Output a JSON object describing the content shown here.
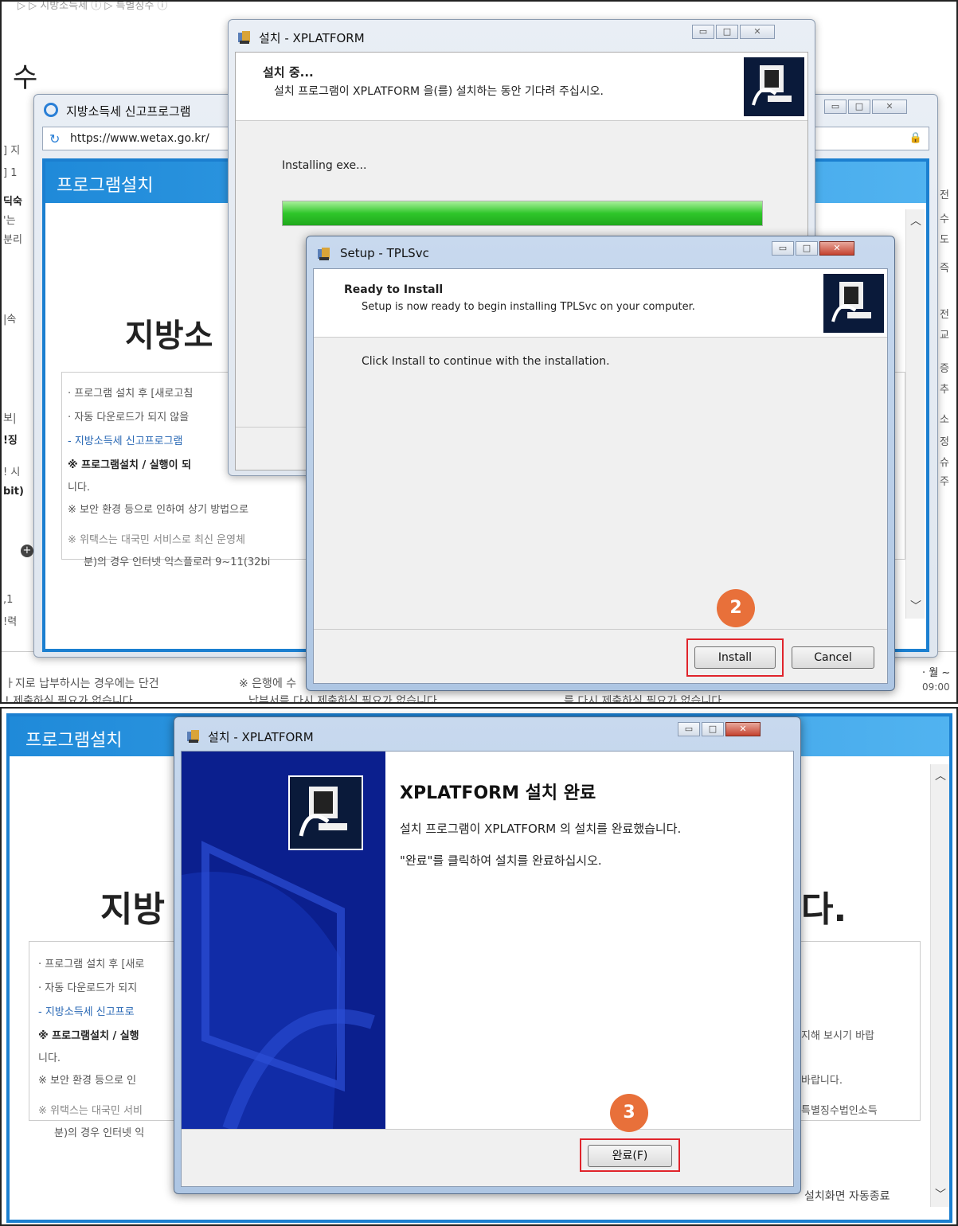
{
  "panel1": {
    "bg_page": {
      "heading_char": "수",
      "breadcrumb_hint": "",
      "left_frags": [
        "] 지",
        "] 1",
        "딕숙",
        "'는",
        "분리",
        "|속",
        "보|",
        "!징",
        "! 시",
        "bit)",
        ",1",
        "!력"
      ],
      "right_frags": [
        "전",
        "수",
        "도",
        "즉",
        "전",
        "교",
        "증",
        "추",
        "소",
        "정",
        "슈",
        "주"
      ],
      "bottom_left": "ㅏ지로 납부하시는 경우에는 단건",
      "bottom_left2": "! 제출하실 필요가 없습니다",
      "bottom_mid": "※ 은행에 수",
      "bottom_mid2": "납부서를 다시 제출하실 필요가 없습니다",
      "bottom_right2": "를 다시 제출하실 필요가 없습니다",
      "right_small1": "· 월 ~",
      "right_small2": "09:00"
    },
    "browser": {
      "title": "지방소득세 신고프로그램",
      "url": "https://www.wetax.go.kr/",
      "panel_title": "프로그램설치",
      "big_heading": "지방소",
      "lines": [
        "· 프로그램 설치 후 [새로고침",
        "· 자동 다운로드가 되지 않을",
        "- 지방소득세 신고프로그램",
        "※ 프로그램설치 / 실행이 되",
        "니다.",
        "※ 보안 환경 등으로 인하여 상기 방법으로",
        "※ 위택스는 대국민 서비스로 최신 운영체",
        "분)의 경우 인터넷 익스플로러 9~11(32bi"
      ]
    },
    "xplatform_dialog": {
      "title": "설치 - XPLATFORM",
      "header_title": "설치 중...",
      "header_sub": "설치 프로그램이 XPLATFORM 을(를) 설치하는 동안 기다려 주십시오.",
      "status": "Installing exe...",
      "progress": 1.0
    },
    "tplsvc_dialog": {
      "title": "Setup - TPLSvc",
      "header_title": "Ready to Install",
      "header_sub": "Setup is now ready to begin installing TPLSvc on your computer.",
      "body": "Click Install to continue with the installation.",
      "install_label": "Install",
      "cancel_label": "Cancel",
      "step_badge": "2"
    }
  },
  "panel2": {
    "bg_page": {
      "panel_title": "프로그램설치",
      "big_left": "지방",
      "big_right": "다.",
      "lines": [
        "· 프로그램 설치 후 [새로",
        "· 자동 다운로드가 되지",
        "- 지방소득세 신고프로",
        "※ 프로그램설치 / 실행",
        "니다.",
        "※ 보안 환경 등으로 인",
        "※ 위택스는 대국민 서비",
        "분)의 경우 인터넷 익"
      ],
      "right_lines": [
        "지해 보시기 바랍",
        "바랍니다.",
        "특별징수법인소득"
      ],
      "bottom_right": "설치화면 자동종료"
    },
    "finish_dialog": {
      "title": "설치 - XPLATFORM",
      "heading": "XPLATFORM 설치 완료",
      "line1": "설치 프로그램이 XPLATFORM 의 설치를 완료했습니다.",
      "line2": "\"완료\"를 클릭하여 설치를 완료하십시오.",
      "finish_label": "완료(F)",
      "step_badge": "3"
    }
  }
}
